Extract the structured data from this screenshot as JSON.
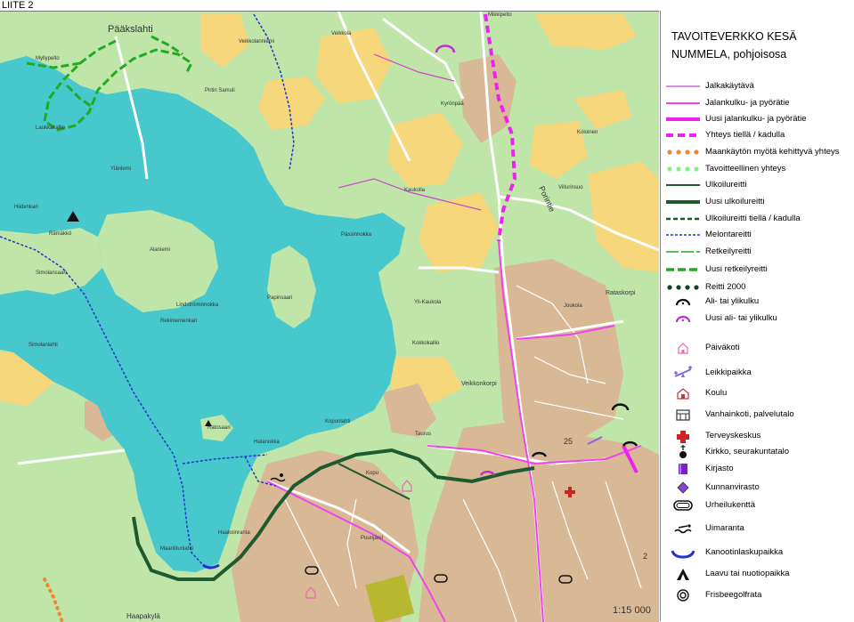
{
  "header": {
    "appendix": "LIITE 2"
  },
  "legend": {
    "title_line1": "TAVOITEVERKKO KESÄ",
    "title_line2": "NUMMELA, pohjoisosa",
    "items": [
      {
        "label": "Jalkakäytävä",
        "symbol": "line",
        "color": "#cc44cc",
        "dash": "none",
        "width": 1.2
      },
      {
        "label": "Jalankulku- ja pyörätie",
        "symbol": "line",
        "color": "#ee44ee",
        "dash": "none",
        "width": 2
      },
      {
        "label": "Uusi jalankulku- ja pyörätie",
        "symbol": "line",
        "color": "#ee22ee",
        "dash": "none",
        "width": 4
      },
      {
        "label": "Yhteys tiellä / kadulla",
        "symbol": "line",
        "color": "#ee22ee",
        "dash": "8,5",
        "width": 4
      },
      {
        "label": "Maankäytön myötä kehittyvä yhteys",
        "symbol": "dots",
        "color": "#ee8833"
      },
      {
        "label": "Tavoitteellinen yhteys",
        "symbol": "dots",
        "color": "#88ee88"
      },
      {
        "label": "Ulkoilureitti",
        "symbol": "line",
        "color": "#1e5a2e",
        "dash": "none",
        "width": 2
      },
      {
        "label": "Uusi ulkoilureitti",
        "symbol": "line",
        "color": "#1e5a2e",
        "dash": "none",
        "width": 4
      },
      {
        "label": "Ulkoilureitti tiellä / kadulla",
        "symbol": "line",
        "color": "#1e5a2e",
        "dash": "5,3",
        "width": 2.5
      },
      {
        "label": "Melontareitti",
        "symbol": "line",
        "color": "#2233cc",
        "dash": "3,2",
        "width": 1.5
      },
      {
        "label": "Retkeilyreitti",
        "symbol": "line",
        "color": "#22aa22",
        "dash": "14,3",
        "width": 1.5
      },
      {
        "label": "Uusi retkeilyreitti",
        "symbol": "line",
        "color": "#22aa22",
        "dash": "9,4",
        "width": 3.5
      },
      {
        "label": "Reitti 2000",
        "symbol": "dots",
        "color": "#114422"
      },
      {
        "label": "Ali- tai ylikulku",
        "symbol": "arc",
        "color": "#111111"
      },
      {
        "label": "Uusi ali- tai ylikulku",
        "symbol": "arc",
        "color": "#bb33cc"
      },
      {
        "label": "Päiväkoti",
        "symbol": "house",
        "color": "#ee66aa"
      },
      {
        "label": "Leikkipaikka",
        "symbol": "seesaw",
        "color": "#8866dd"
      },
      {
        "label": "Koulu",
        "symbol": "school",
        "color": "#cc3333"
      },
      {
        "label": "Vanhainkoti, palvelutalo",
        "symbol": "care",
        "color": "#333333"
      },
      {
        "label": "Terveyskeskus",
        "symbol": "cross",
        "color": "#cc2222"
      },
      {
        "label": "Kirkko, seurakuntatalo",
        "symbol": "church",
        "color": "#111111"
      },
      {
        "label": "Kirjasto",
        "symbol": "book",
        "color": "#7722cc"
      },
      {
        "label": "Kunnanvirasto",
        "symbol": "diamond",
        "color": "#8844cc"
      },
      {
        "label": "Urheilukenttä",
        "symbol": "track",
        "color": "#111111"
      },
      {
        "label": "Uimaranta",
        "symbol": "swim",
        "color": "#111111"
      },
      {
        "label": "Kanootinlaskupaikka",
        "symbol": "canoe",
        "color": "#2233cc"
      },
      {
        "label": "Laavu tai nuotiopaikka",
        "symbol": "tent",
        "color": "#111111"
      },
      {
        "label": "Frisbeegolfrata",
        "symbol": "disc",
        "color": "#111111"
      }
    ]
  },
  "map": {
    "colors": {
      "lake": "#46c8cc",
      "green": "#bfe6a8",
      "field": "#f6d77c",
      "built": "#d9b896",
      "road": "#ffffff",
      "outdoor": "#1e5a2e",
      "pedestrian": "#ee22ee",
      "canoe": "#2233cc",
      "hiking": "#22aa22",
      "planned": "#ee8833"
    },
    "labels": [
      {
        "text": "Pääkslahti",
        "size": 11
      },
      {
        "text": "Myllypelto",
        "size": 6
      },
      {
        "text": "Laukkakallio",
        "size": 6
      },
      {
        "text": "Ylänlemi",
        "size": 6
      },
      {
        "text": "Hiidenkari",
        "size": 6
      },
      {
        "text": "Rämäkkö",
        "size": 6
      },
      {
        "text": "Alaniemi",
        "size": 6
      },
      {
        "text": "Simolansaari",
        "size": 6
      },
      {
        "text": "Simolanlahti",
        "size": 6
      },
      {
        "text": "Lindströminnokka",
        "size": 6
      },
      {
        "text": "Rekiniemenkari",
        "size": 6
      },
      {
        "text": "Papinsaari",
        "size": 6
      },
      {
        "text": "Pirtin Samuli",
        "size": 6
      },
      {
        "text": "Veikkolanniemi",
        "size": 6
      },
      {
        "text": "Veikkola",
        "size": 6
      },
      {
        "text": "Kyrönpää",
        "size": 6
      },
      {
        "text": "Koloinen",
        "size": 6
      },
      {
        "text": "Villurinsuo",
        "size": 6
      },
      {
        "text": "Kaukolla",
        "size": 6
      },
      {
        "text": "Pässinnokka",
        "size": 6
      },
      {
        "text": "Yli-Kaukola",
        "size": 6
      },
      {
        "text": "Joukola",
        "size": 6
      },
      {
        "text": "Rataskorpi",
        "size": 7
      },
      {
        "text": "Kokkokallio",
        "size": 6
      },
      {
        "text": "Veikkonkorpi",
        "size": 7
      },
      {
        "text": "Kopunlahti",
        "size": 6
      },
      {
        "text": "Hatanokka",
        "size": 6
      },
      {
        "text": "Ratosaari",
        "size": 6
      },
      {
        "text": "Haakoinranta",
        "size": 6
      },
      {
        "text": "Maanlitunlahti",
        "size": 6
      },
      {
        "text": "Haapakylä",
        "size": 8
      },
      {
        "text": "Puurijärvi",
        "size": 6
      },
      {
        "text": "Porintie",
        "size": 9
      },
      {
        "text": "Mikkipelto",
        "size": 6
      },
      {
        "text": "Taurus",
        "size": 6
      },
      {
        "text": "Kopu",
        "size": 6
      },
      {
        "text": "25",
        "size": 9
      },
      {
        "text": "2",
        "size": 9
      },
      {
        "text": "1:15 000",
        "size": 11
      }
    ]
  }
}
